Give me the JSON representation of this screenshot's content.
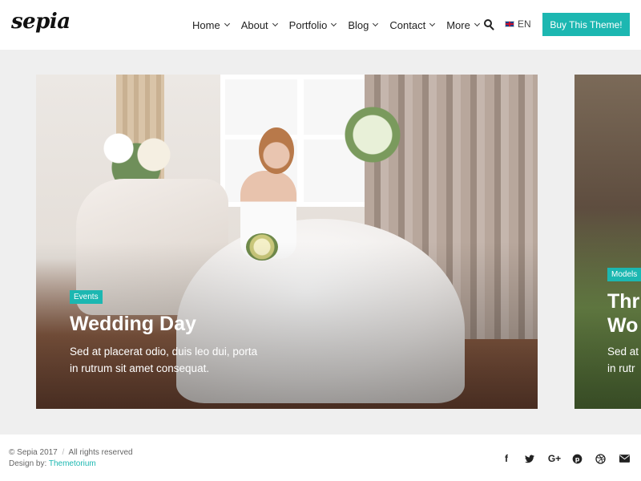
{
  "header": {
    "logo": "sepia",
    "nav": [
      {
        "label": "Home"
      },
      {
        "label": "About"
      },
      {
        "label": "Portfolio"
      },
      {
        "label": "Blog"
      },
      {
        "label": "Contact"
      },
      {
        "label": "More"
      }
    ],
    "language": "EN",
    "buy_button": "Buy This Theme!"
  },
  "slides": [
    {
      "category": "Events",
      "title": "Wedding Day",
      "excerpt_line1": "Sed at placerat odio, duis leo dui, porta",
      "excerpt_line2": "in rutrum sit amet consequat."
    },
    {
      "category": "Models",
      "title_line1": "Thr",
      "title_line2": "Wo",
      "excerpt_line1": "Sed at",
      "excerpt_line2": "in rutr"
    }
  ],
  "footer": {
    "copyright": "© Sepia 2017",
    "separator": "/",
    "rights": "All rights reserved",
    "design_by": "Design by:",
    "designer": "Themetorium"
  },
  "social_icons": [
    "facebook-icon",
    "twitter-icon",
    "google-plus-icon",
    "pinterest-icon",
    "dribbble-icon",
    "email-icon"
  ],
  "colors": {
    "accent": "#1cb7b1",
    "main_bg": "#efefef"
  }
}
